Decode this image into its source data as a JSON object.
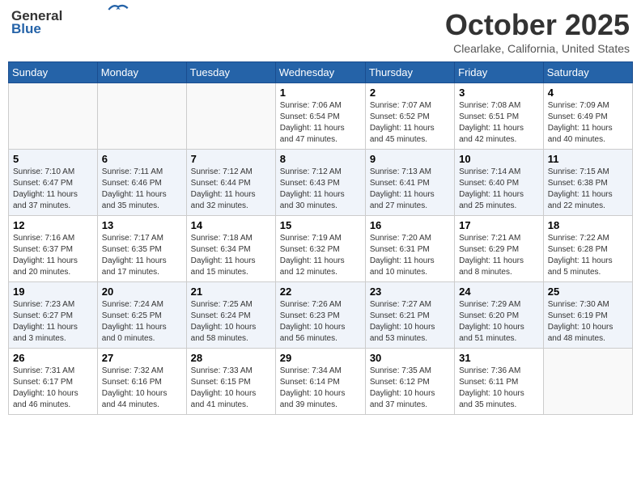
{
  "header": {
    "logo_line1": "General",
    "logo_line2": "Blue",
    "month": "October 2025",
    "location": "Clearlake, California, United States"
  },
  "weekdays": [
    "Sunday",
    "Monday",
    "Tuesday",
    "Wednesday",
    "Thursday",
    "Friday",
    "Saturday"
  ],
  "weeks": [
    [
      {
        "day": "",
        "info": ""
      },
      {
        "day": "",
        "info": ""
      },
      {
        "day": "",
        "info": ""
      },
      {
        "day": "1",
        "info": "Sunrise: 7:06 AM\nSunset: 6:54 PM\nDaylight: 11 hours\nand 47 minutes."
      },
      {
        "day": "2",
        "info": "Sunrise: 7:07 AM\nSunset: 6:52 PM\nDaylight: 11 hours\nand 45 minutes."
      },
      {
        "day": "3",
        "info": "Sunrise: 7:08 AM\nSunset: 6:51 PM\nDaylight: 11 hours\nand 42 minutes."
      },
      {
        "day": "4",
        "info": "Sunrise: 7:09 AM\nSunset: 6:49 PM\nDaylight: 11 hours\nand 40 minutes."
      }
    ],
    [
      {
        "day": "5",
        "info": "Sunrise: 7:10 AM\nSunset: 6:47 PM\nDaylight: 11 hours\nand 37 minutes."
      },
      {
        "day": "6",
        "info": "Sunrise: 7:11 AM\nSunset: 6:46 PM\nDaylight: 11 hours\nand 35 minutes."
      },
      {
        "day": "7",
        "info": "Sunrise: 7:12 AM\nSunset: 6:44 PM\nDaylight: 11 hours\nand 32 minutes."
      },
      {
        "day": "8",
        "info": "Sunrise: 7:12 AM\nSunset: 6:43 PM\nDaylight: 11 hours\nand 30 minutes."
      },
      {
        "day": "9",
        "info": "Sunrise: 7:13 AM\nSunset: 6:41 PM\nDaylight: 11 hours\nand 27 minutes."
      },
      {
        "day": "10",
        "info": "Sunrise: 7:14 AM\nSunset: 6:40 PM\nDaylight: 11 hours\nand 25 minutes."
      },
      {
        "day": "11",
        "info": "Sunrise: 7:15 AM\nSunset: 6:38 PM\nDaylight: 11 hours\nand 22 minutes."
      }
    ],
    [
      {
        "day": "12",
        "info": "Sunrise: 7:16 AM\nSunset: 6:37 PM\nDaylight: 11 hours\nand 20 minutes."
      },
      {
        "day": "13",
        "info": "Sunrise: 7:17 AM\nSunset: 6:35 PM\nDaylight: 11 hours\nand 17 minutes."
      },
      {
        "day": "14",
        "info": "Sunrise: 7:18 AM\nSunset: 6:34 PM\nDaylight: 11 hours\nand 15 minutes."
      },
      {
        "day": "15",
        "info": "Sunrise: 7:19 AM\nSunset: 6:32 PM\nDaylight: 11 hours\nand 12 minutes."
      },
      {
        "day": "16",
        "info": "Sunrise: 7:20 AM\nSunset: 6:31 PM\nDaylight: 11 hours\nand 10 minutes."
      },
      {
        "day": "17",
        "info": "Sunrise: 7:21 AM\nSunset: 6:29 PM\nDaylight: 11 hours\nand 8 minutes."
      },
      {
        "day": "18",
        "info": "Sunrise: 7:22 AM\nSunset: 6:28 PM\nDaylight: 11 hours\nand 5 minutes."
      }
    ],
    [
      {
        "day": "19",
        "info": "Sunrise: 7:23 AM\nSunset: 6:27 PM\nDaylight: 11 hours\nand 3 minutes."
      },
      {
        "day": "20",
        "info": "Sunrise: 7:24 AM\nSunset: 6:25 PM\nDaylight: 11 hours\nand 0 minutes."
      },
      {
        "day": "21",
        "info": "Sunrise: 7:25 AM\nSunset: 6:24 PM\nDaylight: 10 hours\nand 58 minutes."
      },
      {
        "day": "22",
        "info": "Sunrise: 7:26 AM\nSunset: 6:23 PM\nDaylight: 10 hours\nand 56 minutes."
      },
      {
        "day": "23",
        "info": "Sunrise: 7:27 AM\nSunset: 6:21 PM\nDaylight: 10 hours\nand 53 minutes."
      },
      {
        "day": "24",
        "info": "Sunrise: 7:29 AM\nSunset: 6:20 PM\nDaylight: 10 hours\nand 51 minutes."
      },
      {
        "day": "25",
        "info": "Sunrise: 7:30 AM\nSunset: 6:19 PM\nDaylight: 10 hours\nand 48 minutes."
      }
    ],
    [
      {
        "day": "26",
        "info": "Sunrise: 7:31 AM\nSunset: 6:17 PM\nDaylight: 10 hours\nand 46 minutes."
      },
      {
        "day": "27",
        "info": "Sunrise: 7:32 AM\nSunset: 6:16 PM\nDaylight: 10 hours\nand 44 minutes."
      },
      {
        "day": "28",
        "info": "Sunrise: 7:33 AM\nSunset: 6:15 PM\nDaylight: 10 hours\nand 41 minutes."
      },
      {
        "day": "29",
        "info": "Sunrise: 7:34 AM\nSunset: 6:14 PM\nDaylight: 10 hours\nand 39 minutes."
      },
      {
        "day": "30",
        "info": "Sunrise: 7:35 AM\nSunset: 6:12 PM\nDaylight: 10 hours\nand 37 minutes."
      },
      {
        "day": "31",
        "info": "Sunrise: 7:36 AM\nSunset: 6:11 PM\nDaylight: 10 hours\nand 35 minutes."
      },
      {
        "day": "",
        "info": ""
      }
    ]
  ]
}
